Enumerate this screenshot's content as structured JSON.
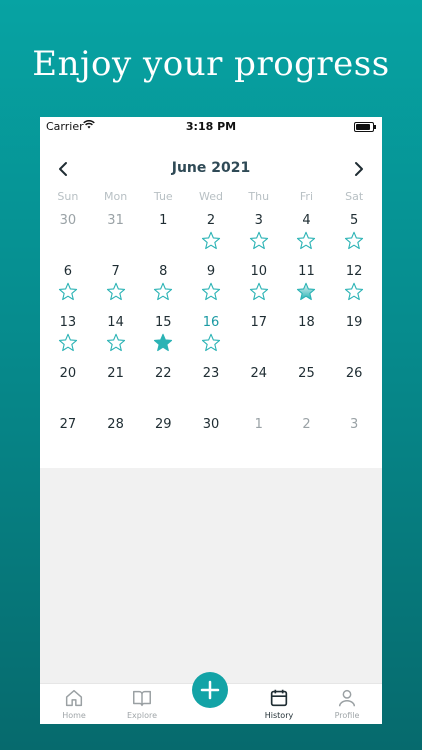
{
  "headline": "Enjoy your progress",
  "status": {
    "carrier": "Carrier",
    "time": "3:18 PM"
  },
  "calendar": {
    "month_label": "June 2021",
    "weekdays": [
      "Sun",
      "Mon",
      "Tue",
      "Wed",
      "Thu",
      "Fri",
      "Sat"
    ],
    "weeks": [
      [
        {
          "d": "30",
          "o": 1
        },
        {
          "d": "31",
          "o": 1
        },
        {
          "d": "1"
        },
        {
          "d": "2",
          "s": "outline"
        },
        {
          "d": "3",
          "s": "outline"
        },
        {
          "d": "4",
          "s": "outline"
        },
        {
          "d": "5",
          "s": "outline"
        }
      ],
      [
        {
          "d": "6",
          "s": "outline"
        },
        {
          "d": "7",
          "s": "outline"
        },
        {
          "d": "8",
          "s": "outline"
        },
        {
          "d": "9",
          "s": "outline"
        },
        {
          "d": "10",
          "s": "outline"
        },
        {
          "d": "11",
          "s": "partial"
        },
        {
          "d": "12",
          "s": "outline"
        }
      ],
      [
        {
          "d": "13",
          "s": "outline"
        },
        {
          "d": "14",
          "s": "outline"
        },
        {
          "d": "15",
          "s": "filled"
        },
        {
          "d": "16",
          "s": "outline",
          "t": 1
        },
        {
          "d": "17"
        },
        {
          "d": "18"
        },
        {
          "d": "19"
        }
      ],
      [
        {
          "d": "20"
        },
        {
          "d": "21"
        },
        {
          "d": "22"
        },
        {
          "d": "23"
        },
        {
          "d": "24"
        },
        {
          "d": "25"
        },
        {
          "d": "26"
        }
      ],
      [
        {
          "d": "27"
        },
        {
          "d": "28"
        },
        {
          "d": "29"
        },
        {
          "d": "30"
        },
        {
          "d": "1",
          "o": 1
        },
        {
          "d": "2",
          "o": 1
        },
        {
          "d": "3",
          "o": 1
        }
      ]
    ]
  },
  "tabs": [
    {
      "label": "Home",
      "icon": "home-icon"
    },
    {
      "label": "Explore",
      "icon": "book-icon"
    },
    {
      "label": "History",
      "icon": "calendar-icon",
      "active": true
    },
    {
      "label": "Profile",
      "icon": "person-icon"
    }
  ],
  "fab_icon": "plus-icon",
  "colors": {
    "accent": "#13a3a6",
    "star": "#2bb3b5",
    "today": "#1b9aa3"
  }
}
